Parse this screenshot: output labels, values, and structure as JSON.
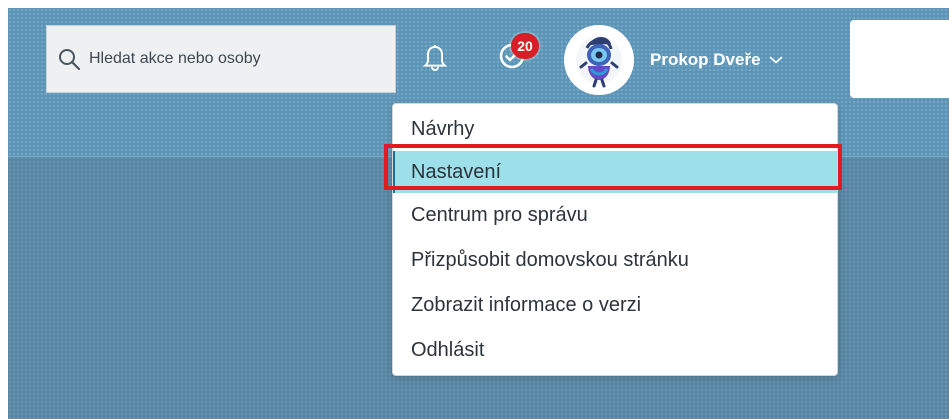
{
  "header": {
    "search": {
      "placeholder": "Hledat akce nebo osoby"
    },
    "notifications": {
      "icon": "bell-icon"
    },
    "todo": {
      "icon": "check-circle-icon",
      "badge_count": "20"
    },
    "user": {
      "name": "Prokop Dveře",
      "avatar_icon": "robot-avatar-icon",
      "chevron_icon": "chevron-down-icon"
    }
  },
  "user_menu": {
    "items": [
      {
        "label": "Návrhy"
      },
      {
        "label": "Nastavení"
      },
      {
        "label": "Centrum pro správu"
      },
      {
        "label": "Přizpůsobit domovskou stránku"
      },
      {
        "label": "Zobrazit informace o verzi"
      },
      {
        "label": "Odhlásit"
      }
    ],
    "active_index": 1
  },
  "colors": {
    "header": "#5f98ba",
    "background": "#5b8aa7",
    "active_item": "#9ee0ea",
    "badge": "#d61f26",
    "highlight": "#e11b22"
  }
}
